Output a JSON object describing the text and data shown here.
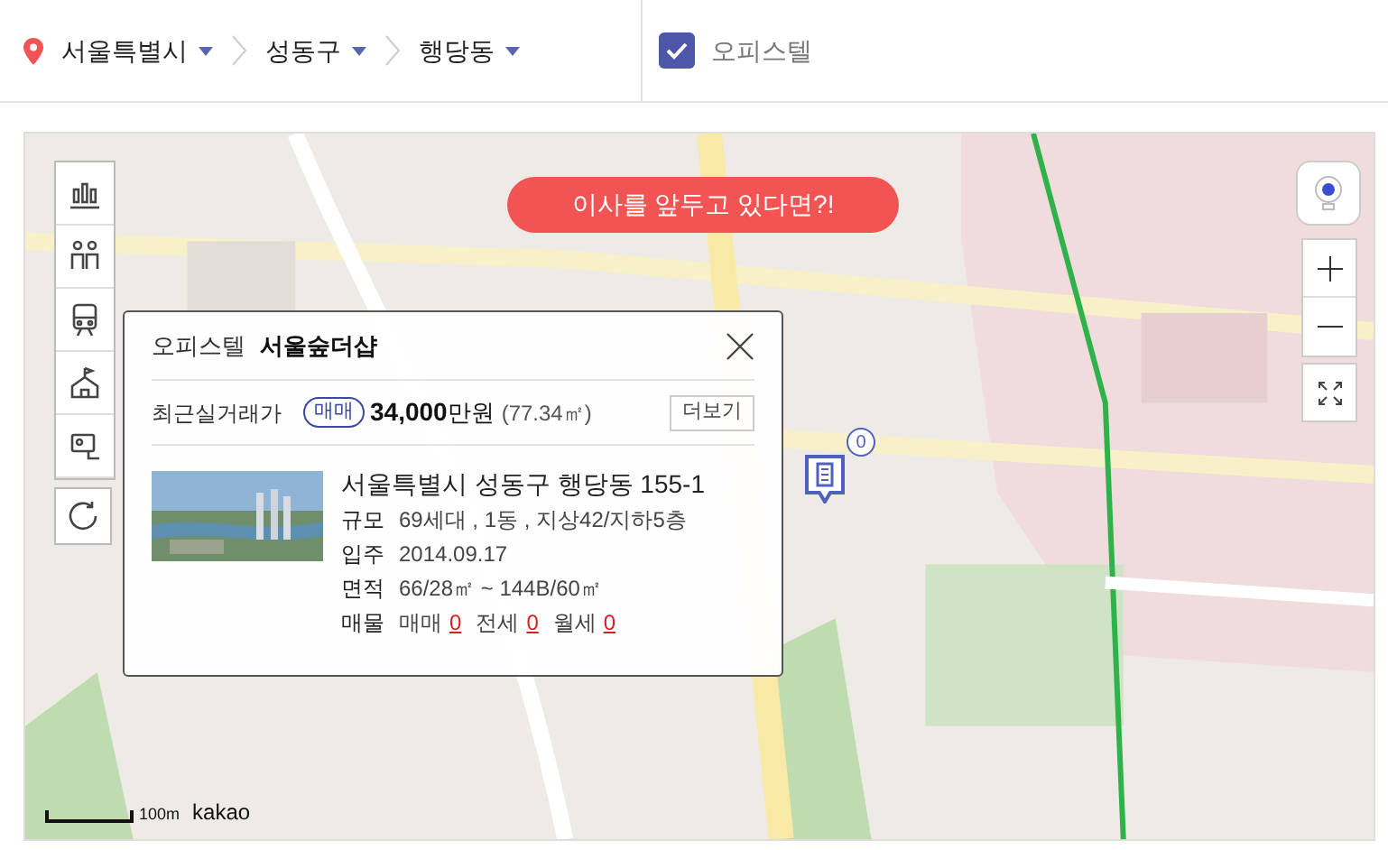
{
  "breadcrumbs": [
    {
      "label": "서울특별시"
    },
    {
      "label": "성동구"
    },
    {
      "label": "행당동"
    }
  ],
  "filters": [
    {
      "label": "오피스텔",
      "checked": true
    }
  ],
  "map": {
    "promo_button": "이사를 앞두고 있다면?!",
    "marker": {
      "count": "0"
    },
    "scale": "100m",
    "logo": "kakao"
  },
  "popup": {
    "type_label": "오피스텔",
    "name": "서울숲더샵",
    "recent_price_label": "최근실거래가",
    "deal_badge": "매매",
    "price": "34,000",
    "price_unit": "만원",
    "area": "(77.34㎡)",
    "more_button": "더보기",
    "address": "서울특별시 성동구 행당동 155-1",
    "details": [
      {
        "label": "규모",
        "value": "69세대 , 1동 , 지상42/지하5층"
      },
      {
        "label": "입주",
        "value": "2014.09.17"
      },
      {
        "label": "면적",
        "value": "66/28㎡ ~ 144B/60㎡"
      }
    ],
    "listings_label": "매물",
    "listings": [
      {
        "label": "매매",
        "count": "0"
      },
      {
        "label": "전세",
        "count": "0"
      },
      {
        "label": "월세",
        "count": "0"
      }
    ]
  }
}
